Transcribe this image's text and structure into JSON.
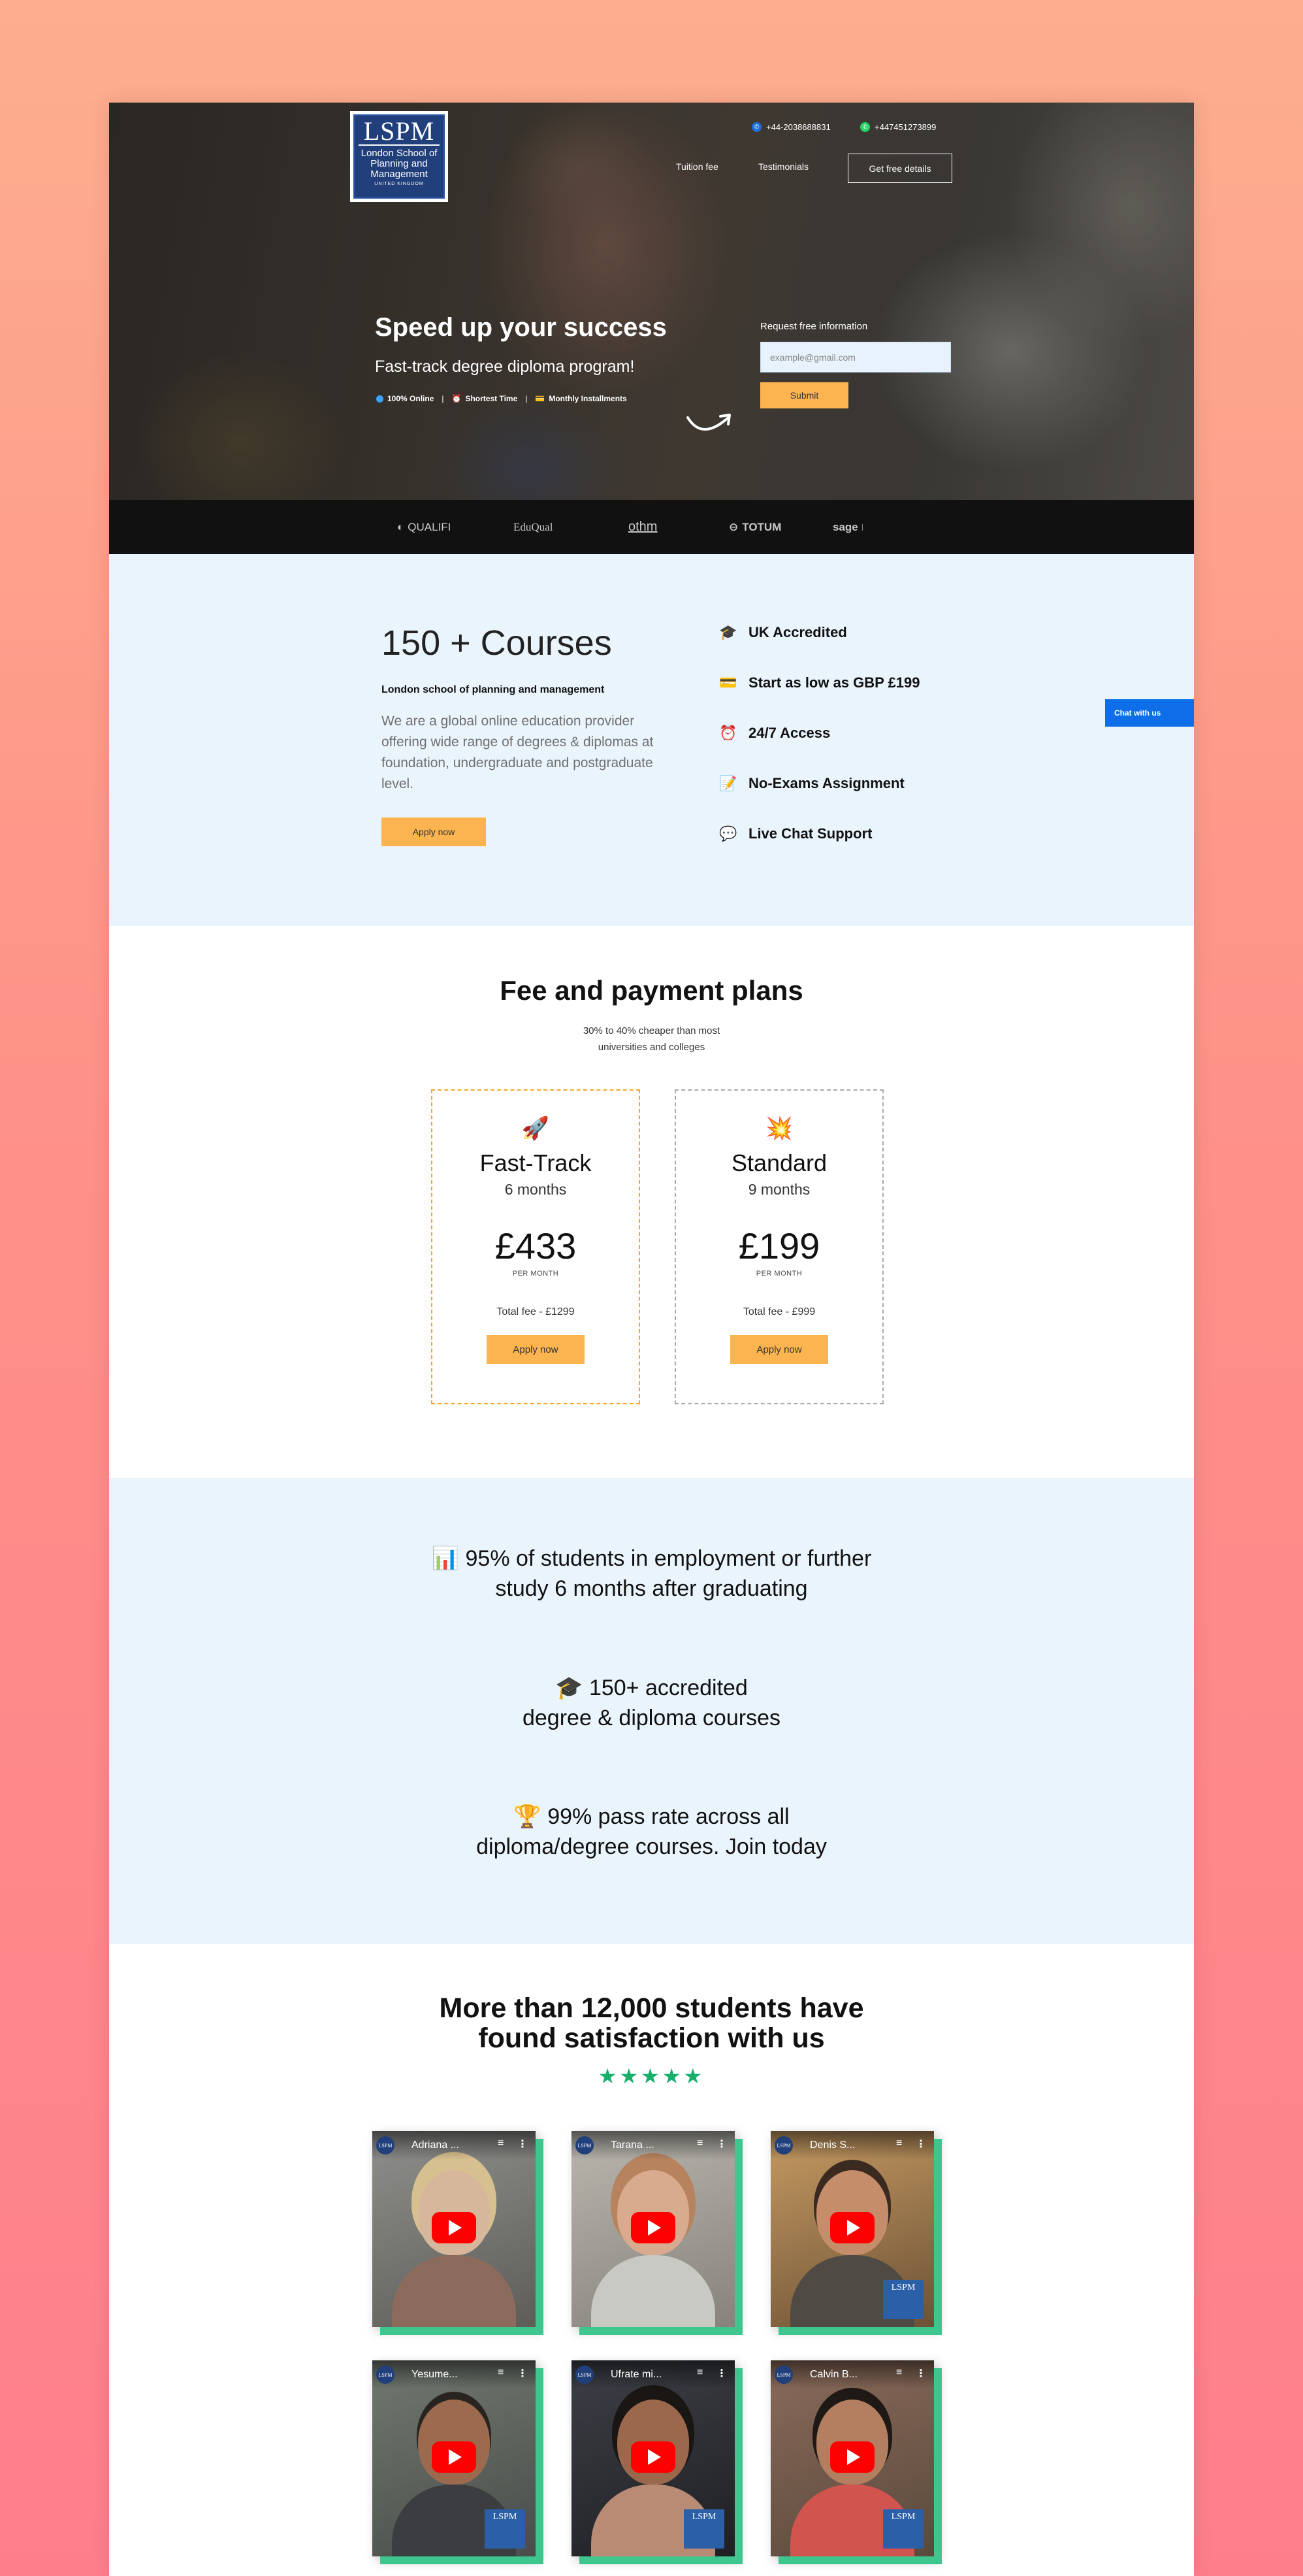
{
  "header": {
    "logo_mark": "LSPM",
    "logo_text": "London School of Planning and Management",
    "logo_sub": "UNITED KINGDOM",
    "phone": "+44-2038688831",
    "whatsapp": "+447451273899",
    "nav": [
      "Tuition fee",
      "Testimonials"
    ],
    "cta": "Get free details"
  },
  "hero": {
    "headline": "Speed up your success",
    "subheadline": "Fast-track degree diploma program!",
    "features": [
      "100% Online",
      "Shortest Time",
      "Monthly Installments"
    ],
    "form_label": "Request free information",
    "email_placeholder": "example@gmail.com",
    "submit": "Submit"
  },
  "partners": [
    "QUALIFI",
    "EduQual",
    "othm",
    "TOTUM",
    "sage"
  ],
  "courses": {
    "title": "150 + Courses",
    "school": "London school of planning and  management",
    "description": "We are a global online education provider offering wide range of degrees & diplomas at foundation, undergraduate and postgraduate level.",
    "apply": "Apply now",
    "perks": [
      {
        "icon": "graduation-cap-icon",
        "glyph": "🎓",
        "label": "UK Accredited"
      },
      {
        "icon": "credit-card-icon",
        "glyph": "💳",
        "label": "Start as low as GBP £199"
      },
      {
        "icon": "alarm-clock-icon",
        "glyph": "⏰",
        "label": "24/7 Access"
      },
      {
        "icon": "notepad-icon",
        "glyph": "📝",
        "label": "No-Exams Assignment"
      },
      {
        "icon": "chat-bubble-icon",
        "glyph": "💬",
        "label": "Live Chat Support"
      }
    ],
    "chat_tab": "Chat with us"
  },
  "fees": {
    "title": "Fee and payment plans",
    "subtitle_1": "30% to 40% cheaper than most",
    "subtitle_2": "universities and colleges",
    "plans": [
      {
        "icon": "rocket-icon",
        "glyph": "🚀",
        "name": "Fast-Track",
        "duration": "6 months",
        "price": "£433",
        "per": "PER MONTH",
        "total": "Total fee - £1299",
        "apply": "Apply now"
      },
      {
        "icon": "star-burst-icon",
        "glyph": "💥",
        "name": "Standard",
        "duration": "9 months",
        "price": "£199",
        "per": "PER MONTH",
        "total": "Total fee - £999",
        "apply": "Apply now"
      }
    ]
  },
  "stats": [
    {
      "icon": "bar-chart-icon",
      "glyph": "📊",
      "line1": "95% of students in employment or further",
      "line2": "study 6 months after graduating"
    },
    {
      "icon": "graduation-cap-icon",
      "glyph": "🎓",
      "line1": "150+ accredited",
      "line2": "degree & diploma courses"
    },
    {
      "icon": "trophy-icon",
      "glyph": "🏆",
      "line1": "99% pass rate across all",
      "line2": "diploma/degree courses. Join today"
    }
  ],
  "testimonials": {
    "title_1": "More than 12,000 students have",
    "title_2": "found satisfaction with us",
    "stars": "★★★★★",
    "videos": [
      {
        "title": "Adriana ..."
      },
      {
        "title": "Tarana ..."
      },
      {
        "title": "Denis S..."
      },
      {
        "title": "Yesume..."
      },
      {
        "title": "Ufrate mi..."
      },
      {
        "title": "Calvin B..."
      }
    ]
  },
  "colors": {
    "accent": "#fbb450",
    "chat_blue": "#0d6ee8",
    "section_bg": "#eaf4fd",
    "stars": "#16b06c",
    "video_shadow": "#3fc68e"
  }
}
